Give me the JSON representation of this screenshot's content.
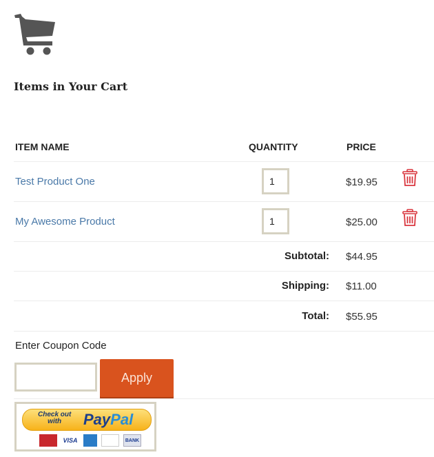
{
  "header": {
    "title": "Items in Your Cart",
    "icon": "shopping-cart-icon"
  },
  "table": {
    "columns": [
      "ITEM NAME",
      "QUANTITY",
      "PRICE"
    ],
    "rows": [
      {
        "name": "Test Product One",
        "quantity": "1",
        "price": "$19.95"
      },
      {
        "name": "My Awesome Product",
        "quantity": "1",
        "price": "$25.00"
      }
    ],
    "totals": [
      {
        "label": "Subtotal:",
        "value": "$44.95"
      },
      {
        "label": "Shipping:",
        "value": "$11.00"
      },
      {
        "label": "Total:",
        "value": "$55.95"
      }
    ]
  },
  "coupon": {
    "label": "Enter Coupon Code",
    "value": "",
    "apply_label": "Apply"
  },
  "paypal": {
    "check_out_text": "Check out",
    "with_text": "with",
    "brand_pay": "Pay",
    "brand_pal": "Pal",
    "cards": [
      "MasterCard",
      "VISA",
      "AMEX",
      "DISCOVER",
      "BANK"
    ]
  },
  "colors": {
    "link": "#4a79a8",
    "apply_button": "#d9531e",
    "trash": "#d9363e"
  }
}
